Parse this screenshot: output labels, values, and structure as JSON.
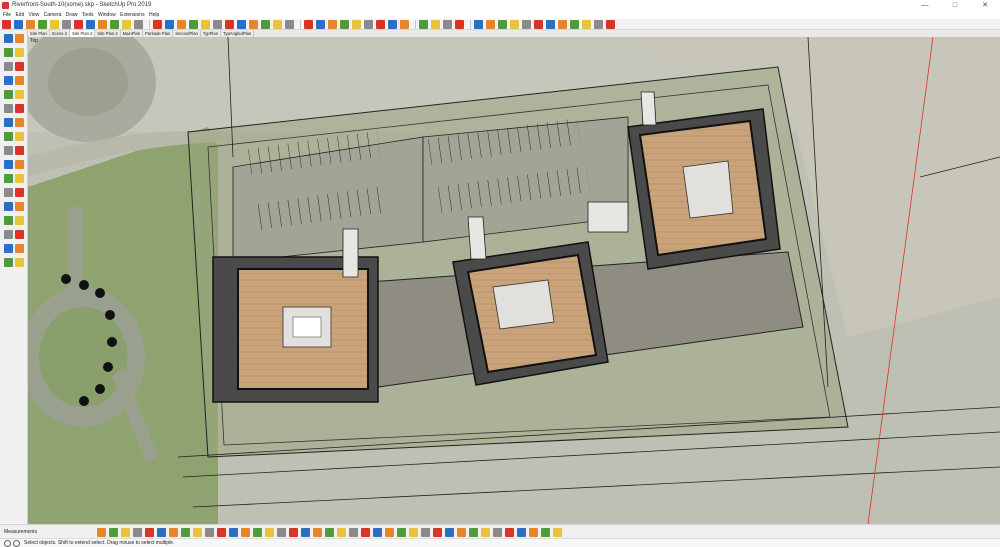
{
  "window": {
    "title": "Riverfront-South-10(some).skp - SketchUp Pro 2019",
    "minimize": "—",
    "maximize": "□",
    "close": "✕"
  },
  "menu": [
    "File",
    "Edit",
    "View",
    "Camera",
    "Draw",
    "Tools",
    "Window",
    "Extensions",
    "Help"
  ],
  "scene_tabs": [
    {
      "label": "Site Plan",
      "active": false
    },
    {
      "label": "Scene 2",
      "active": false
    },
    {
      "label": "Site Plan 2",
      "active": true
    },
    {
      "label": "Site Plan 4",
      "active": false
    },
    {
      "label": "MainPlan",
      "active": false
    },
    {
      "label": "Parkade Plan",
      "active": false
    },
    {
      "label": "SecondPlan",
      "active": false
    },
    {
      "label": "TypPlan",
      "active": false
    },
    {
      "label": "TypAngledPlan",
      "active": false
    }
  ],
  "viewport": {
    "view_name": "Top"
  },
  "measurements": {
    "label": "Measurements"
  },
  "status": {
    "hint": "Select objects. Shift to extend select. Drag mouse to select multiple."
  },
  "toolbar_icons": [
    "move-icon",
    "rotate-icon",
    "scale-icon",
    "offset-icon",
    "undo-icon",
    "redo-icon",
    "flip-icon",
    "intersect-icon",
    "zoom-icon",
    "zoom-extents-icon",
    "paint-icon",
    "tape-icon",
    "|",
    "grid-icon",
    "section-icon",
    "layers-icon",
    "circle-icon",
    "polygon-icon",
    "arc-icon",
    "rectangle-icon",
    "pushpull-icon",
    "followme-icon",
    "outline-icon",
    "eraser-icon",
    "pencil-icon",
    "|",
    "camera-icon",
    "position-camera-icon",
    "walk-icon",
    "look-icon",
    "house-icon",
    "front-view-icon",
    "right-view-icon",
    "back-view-icon",
    "left-view-icon",
    "|",
    "select-icon",
    "component-icon",
    "paint-bucket-icon",
    "eraser-tool-icon",
    "|",
    "box-icon",
    "cylinder-icon",
    "sphere-icon",
    "cone-icon",
    "text-icon",
    "dimension-icon",
    "protractor-icon",
    "axes-icon",
    "warehouse-icon",
    "globe-icon",
    "extension-icon",
    "download-icon"
  ],
  "bottom_icons": [
    "orbit-icon",
    "pan-icon",
    "zoom-window-icon",
    "zoom-previous-icon",
    "walk-through-icon",
    "look-around-icon",
    "section-plane-icon",
    "display-section-icon",
    "xray-icon",
    "wireframe-icon",
    "hidden-line-icon",
    "shaded-icon",
    "textured-icon",
    "monochrome-icon",
    "sandbox-icon",
    "smoove-icon",
    "stamp-icon",
    "drape-icon",
    "add-detail-icon",
    "flip-edge-icon",
    "styles-icon",
    "shadows-icon",
    "fog-icon",
    "match-photo-icon",
    "soften-icon",
    "outliner-icon",
    "entity-info-icon",
    "materials-icon",
    "components-icon",
    "scenes-icon",
    "layers-panel-icon",
    "instructor-icon",
    "location-icon",
    "geo-icon",
    "terrain-icon",
    "photo-icon",
    "sun-icon",
    "leaf-icon",
    "render-icon"
  ],
  "left_icons": [
    "select-arrow-icon",
    "component-shape-icon",
    "paint-bucket-icon",
    "eraser-icon",
    "pencil-line-icon",
    "freehand-icon",
    "rectangle-icon",
    "rotated-rect-icon",
    "circle-icon",
    "polygon-icon",
    "arc-icon",
    "two-point-arc-icon",
    "pie-icon",
    "three-point-arc-icon",
    "move-arrows-icon",
    "pushpull-icon",
    "rotate-circle-icon",
    "follow-me-icon",
    "scale-icon",
    "offset-icon",
    "tape-measure-icon",
    "text-tag-icon",
    "protractor-icon",
    "axes-icon",
    "dimension-icon",
    "3d-text-icon",
    "orbit-icon",
    "pan-hand-icon",
    "zoom-icon",
    "zoom-window-icon",
    "zoom-extents-icon",
    "previous-icon",
    "position-camera-icon",
    "walk-icon"
  ],
  "colors": {
    "accent_red": "#d9342b",
    "accent_blue": "#2a6fc4",
    "accent_orange": "#e4862b",
    "accent_green": "#4f9b3a",
    "accent_yellow": "#e8c43a",
    "accent_gray": "#8a8a8a"
  }
}
